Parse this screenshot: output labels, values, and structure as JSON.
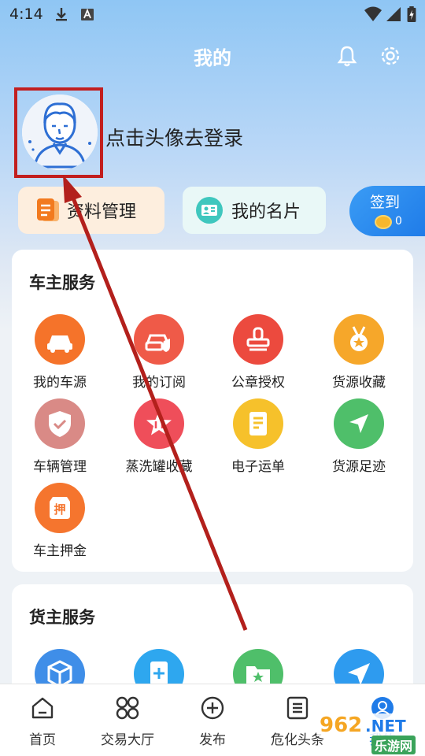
{
  "status_bar": {
    "time": "4:14"
  },
  "header": {
    "title": "我的"
  },
  "profile": {
    "login_prompt": "点击头像去登录"
  },
  "quick_actions": {
    "data_manage": "资料管理",
    "my_card": "我的名片",
    "checkin": {
      "label": "签到",
      "coins": "0"
    }
  },
  "owner_services": {
    "title": "车主服务",
    "items": [
      {
        "label": "我的车源",
        "icon": "truck-icon",
        "color": "#f5732a"
      },
      {
        "label": "我的订阅",
        "icon": "car-check-icon",
        "color": "#ef5a48"
      },
      {
        "label": "公章授权",
        "icon": "stamp-icon",
        "color": "#ec4a3e"
      },
      {
        "label": "货源收藏",
        "icon": "medal-icon",
        "color": "#f6a72a"
      },
      {
        "label": "车辆管理",
        "icon": "shield-check-icon",
        "color": "#d98a86"
      },
      {
        "label": "蒸洗罐收藏",
        "icon": "star-icon",
        "color": "#ef4e5a"
      },
      {
        "label": "电子运单",
        "icon": "document-icon",
        "color": "#f6c12b"
      },
      {
        "label": "货源足迹",
        "icon": "location-arrow-icon",
        "color": "#4fbf6a"
      },
      {
        "label": "车主押金",
        "icon": "deposit-icon",
        "color": "#f5752e"
      }
    ]
  },
  "cargo_services": {
    "title": "货主服务",
    "items": [
      {
        "icon": "box-icon",
        "color": "#3f8ee8"
      },
      {
        "icon": "add-document-icon",
        "color": "#2ea7ef"
      },
      {
        "icon": "folder-star-icon",
        "color": "#4fbf6a"
      },
      {
        "icon": "send-icon",
        "color": "#2e9bef"
      }
    ]
  },
  "bottom_nav": [
    {
      "label": "首页"
    },
    {
      "label": "交易大厅"
    },
    {
      "label": "发布"
    },
    {
      "label": "危化头条"
    },
    {
      "label": "我的"
    }
  ],
  "watermark": {
    "brand": "962",
    "suffix": ".NET",
    "sub": "乐游网"
  },
  "colors": {
    "accent_blue": "#1f7be8",
    "annotation_red": "#c21f1f"
  }
}
